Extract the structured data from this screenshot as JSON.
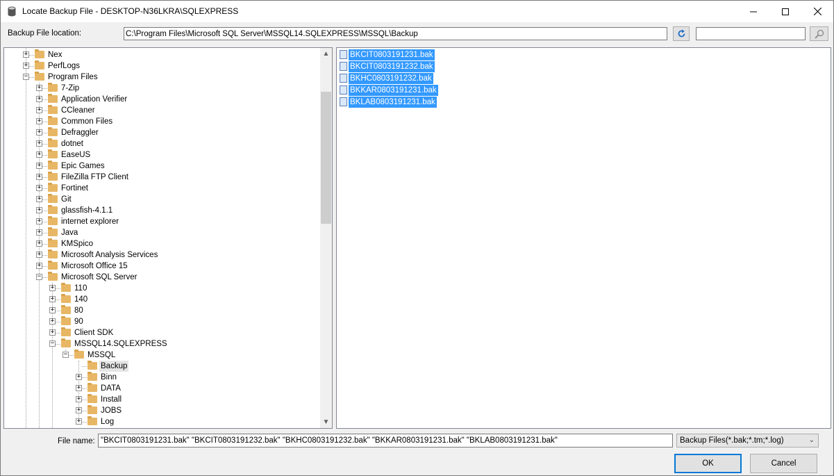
{
  "window": {
    "title": "Locate Backup File - DESKTOP-N36LKRA\\SQLEXPRESS",
    "minimize_glyph": "—",
    "maximize_glyph": "☐",
    "close_glyph": "✕"
  },
  "location": {
    "label": "Backup File location:",
    "value": "C:\\Program Files\\Microsoft SQL Server\\MSSQL14.SQLEXPRESS\\MSSQL\\Backup",
    "refresh_icon": "refresh-icon",
    "search_value": "",
    "search_icon": "search-icon"
  },
  "tree": {
    "items": [
      {
        "label": "Nex",
        "level": 1,
        "expander": "+",
        "selected": false
      },
      {
        "label": "PerfLogs",
        "level": 1,
        "expander": "+",
        "selected": false
      },
      {
        "label": "Program Files",
        "level": 1,
        "expander": "−",
        "selected": false
      },
      {
        "label": "7-Zip",
        "level": 2,
        "expander": "+",
        "selected": false
      },
      {
        "label": "Application Verifier",
        "level": 2,
        "expander": "+",
        "selected": false
      },
      {
        "label": "CCleaner",
        "level": 2,
        "expander": "+",
        "selected": false
      },
      {
        "label": "Common Files",
        "level": 2,
        "expander": "+",
        "selected": false
      },
      {
        "label": "Defraggler",
        "level": 2,
        "expander": "+",
        "selected": false
      },
      {
        "label": "dotnet",
        "level": 2,
        "expander": "+",
        "selected": false
      },
      {
        "label": "EaseUS",
        "level": 2,
        "expander": "+",
        "selected": false
      },
      {
        "label": "Epic Games",
        "level": 2,
        "expander": "+",
        "selected": false
      },
      {
        "label": "FileZilla FTP Client",
        "level": 2,
        "expander": "+",
        "selected": false
      },
      {
        "label": "Fortinet",
        "level": 2,
        "expander": "+",
        "selected": false
      },
      {
        "label": "Git",
        "level": 2,
        "expander": "+",
        "selected": false
      },
      {
        "label": "glassfish-4.1.1",
        "level": 2,
        "expander": "+",
        "selected": false
      },
      {
        "label": "internet explorer",
        "level": 2,
        "expander": "+",
        "selected": false
      },
      {
        "label": "Java",
        "level": 2,
        "expander": "+",
        "selected": false
      },
      {
        "label": "KMSpico",
        "level": 2,
        "expander": "+",
        "selected": false
      },
      {
        "label": "Microsoft Analysis Services",
        "level": 2,
        "expander": "+",
        "selected": false
      },
      {
        "label": "Microsoft Office 15",
        "level": 2,
        "expander": "+",
        "selected": false
      },
      {
        "label": "Microsoft SQL Server",
        "level": 2,
        "expander": "−",
        "selected": false
      },
      {
        "label": "110",
        "level": 3,
        "expander": "+",
        "selected": false
      },
      {
        "label": "140",
        "level": 3,
        "expander": "+",
        "selected": false
      },
      {
        "label": "80",
        "level": 3,
        "expander": "+",
        "selected": false
      },
      {
        "label": "90",
        "level": 3,
        "expander": "+",
        "selected": false
      },
      {
        "label": "Client SDK",
        "level": 3,
        "expander": "+",
        "selected": false
      },
      {
        "label": "MSSQL14.SQLEXPRESS",
        "level": 3,
        "expander": "−",
        "selected": false
      },
      {
        "label": "MSSQL",
        "level": 4,
        "expander": "−",
        "selected": false
      },
      {
        "label": "Backup",
        "level": 5,
        "expander": "",
        "selected": true
      },
      {
        "label": "Binn",
        "level": 5,
        "expander": "+",
        "selected": false
      },
      {
        "label": "DATA",
        "level": 5,
        "expander": "+",
        "selected": false
      },
      {
        "label": "Install",
        "level": 5,
        "expander": "+",
        "selected": false
      },
      {
        "label": "JOBS",
        "level": 5,
        "expander": "+",
        "selected": false
      },
      {
        "label": "Log",
        "level": 5,
        "expander": "+",
        "selected": false
      }
    ],
    "scroll_up_glyph": "▲",
    "scroll_down_glyph": "▼"
  },
  "files": [
    {
      "name": "BKCIT0803191231.bak",
      "selected": true
    },
    {
      "name": "BKCIT0803191232.bak",
      "selected": true
    },
    {
      "name": "BKHC0803191232.bak",
      "selected": true
    },
    {
      "name": "BKKAR0803191231.bak",
      "selected": true
    },
    {
      "name": "BKLAB0803191231.bak",
      "selected": true
    }
  ],
  "footer": {
    "filename_label": "File name:",
    "filename_value": "\"BKCIT0803191231.bak\" \"BKCIT0803191232.bak\" \"BKHC0803191232.bak\" \"BKKAR0803191231.bak\" \"BKLAB0803191231.bak\"",
    "filter_value": "Backup Files(*.bak;*.tm;*.log)",
    "filter_chevron": "⌄",
    "ok_label": "OK",
    "cancel_label": "Cancel"
  },
  "colors": {
    "selection": "#3399ff",
    "folder": "#e8b765",
    "default_button_border": "#0078d7"
  }
}
